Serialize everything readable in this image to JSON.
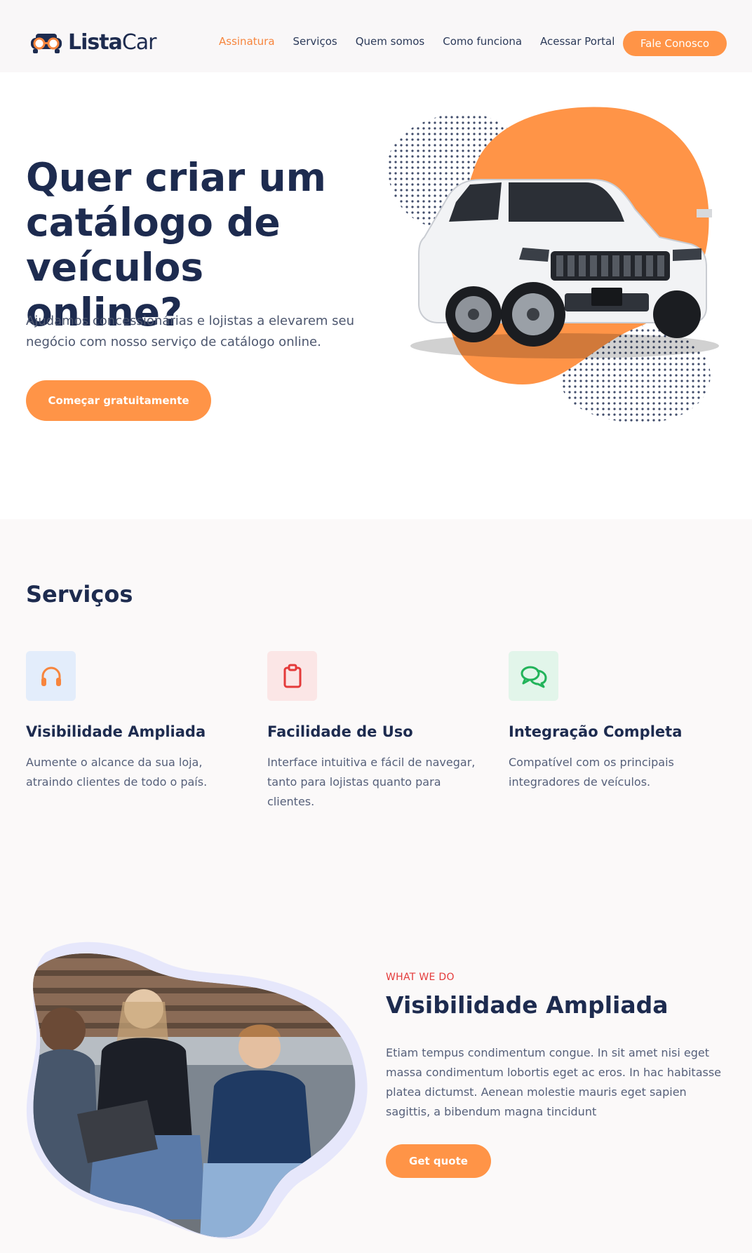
{
  "header": {
    "logo_bold": "Lista",
    "logo_light": "Car",
    "nav": [
      "Assinatura",
      "Serviços",
      "Quem somos",
      "Como funciona",
      "Acessar Portal"
    ],
    "cta": "Fale Conosco"
  },
  "hero": {
    "title": "Quer criar um catálogo de veículos online?",
    "subtitle": "Ajudamos concessionárias e lojistas a elevarem seu negócio com nosso serviço de catálogo online.",
    "button": "Começar gratuitamente"
  },
  "services": {
    "title": "Serviços",
    "items": [
      {
        "title": "Visibilidade Ampliada",
        "text": "Aumente o alcance da sua loja, atraindo clientes de todo o país.",
        "icon": "headphones-icon"
      },
      {
        "title": "Facilidade de Uso",
        "text": "Interface intuitiva e fácil de navegar, tanto para lojistas quanto para clientes.",
        "icon": "clipboard-icon"
      },
      {
        "title": "Integração Completa",
        "text": "Compatível com os principais integradores de veículos.",
        "icon": "chat-bubbles-icon"
      }
    ]
  },
  "feature": {
    "eyebrow": "WHAT WE DO",
    "title": "Visibilidade Ampliada",
    "text": "Etiam tempus condimentum congue. In sit amet nisi eget massa condimentum lobortis eget ac eros. In hac habitasse platea dictumst. Aenean molestie mauris eget sapien sagittis, a bibendum magna tincidunt",
    "button": "Get quote"
  },
  "colors": {
    "accent": "#ff9447",
    "navy": "#1d2b4f",
    "eyebrow": "#e43a3a"
  }
}
